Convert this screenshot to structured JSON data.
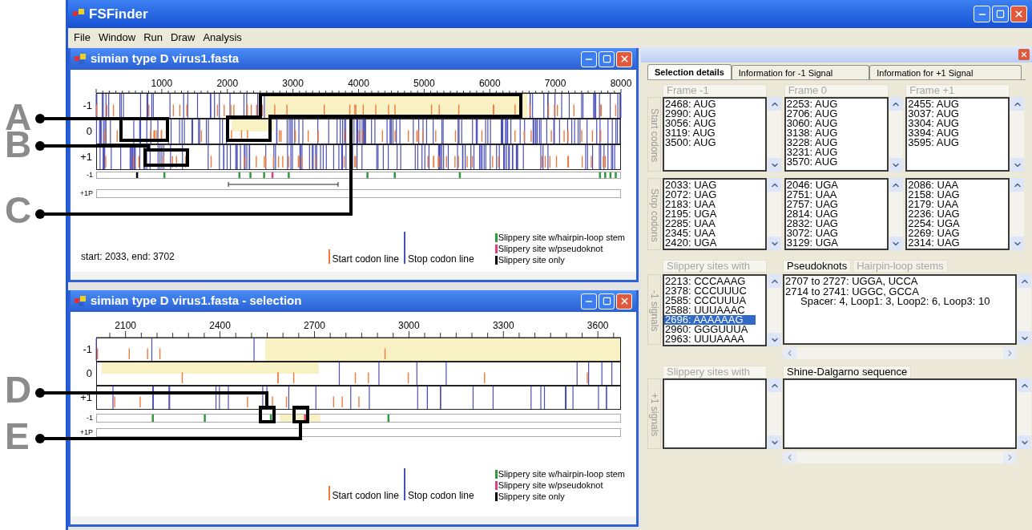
{
  "window": {
    "title": "FSFinder"
  },
  "menu": [
    "File",
    "Window",
    "Run",
    "Draw",
    "Analysis"
  ],
  "callouts": [
    {
      "label": "A"
    },
    {
      "label": "B"
    },
    {
      "label": "C"
    },
    {
      "label": "D"
    },
    {
      "label": "E"
    }
  ],
  "documents": [
    {
      "title": "simian type D virus1.fasta",
      "ticks": [
        "1000",
        "2000",
        "3000",
        "4000",
        "5000",
        "6000",
        "7000",
        "8000"
      ],
      "frames": [
        "-1",
        "0",
        "+1"
      ],
      "signal_tracks": [
        "-1",
        "+1P"
      ],
      "status": "start: 2033, end: 3702",
      "legend": [
        {
          "kind": "start",
          "label": "Start codon line",
          "color": "#f07a3a"
        },
        {
          "kind": "stop",
          "label": "Stop codon line",
          "color": "#4b4fb8"
        },
        {
          "kind": "site",
          "label": "Slippery site w/hairpin-loop stem",
          "color": "#2e9a3c"
        },
        {
          "kind": "site",
          "label": "Slippery site w/pseudoknot",
          "color": "#e0407e"
        },
        {
          "kind": "site",
          "label": "Slippery site only",
          "color": "#000000"
        }
      ]
    },
    {
      "title": "simian type D virus1.fasta - selection",
      "ticks": [
        "2100",
        "2400",
        "2700",
        "3000",
        "3300",
        "3600"
      ],
      "frames": [
        "-1",
        "0",
        "+1"
      ],
      "signal_tracks": [
        "-1",
        "+1P"
      ],
      "legend": [
        {
          "kind": "start",
          "label": "Start codon line",
          "color": "#f07a3a"
        },
        {
          "kind": "stop",
          "label": "Stop codon line",
          "color": "#4b4fb8"
        },
        {
          "kind": "site",
          "label": "Slippery site w/hairpin-loop stem",
          "color": "#2e9a3c"
        },
        {
          "kind": "site",
          "label": "Slippery site w/pseudoknot",
          "color": "#e0407e"
        },
        {
          "kind": "site",
          "label": "Slippery site only",
          "color": "#000000"
        }
      ]
    }
  ],
  "panel": {
    "tabs": [
      {
        "label": "Selection details",
        "selected": true
      },
      {
        "label": "Information for -1 Signal",
        "selected": false
      },
      {
        "label": "Information for +1 Signal",
        "selected": false
      }
    ],
    "row_labels": [
      "Start codons",
      "Stop codons"
    ],
    "frames": [
      {
        "header": "Frame -1",
        "start": [
          "2468: AUG",
          "2990: AUG",
          "3056: AUG",
          "3119: AUG",
          "3500: AUG"
        ],
        "stop": [
          "2033: UAG",
          "2072: UAG",
          "2183: UAA",
          "2195: UGA",
          "2285: UAA",
          "2345: UAA",
          "2420: UGA"
        ]
      },
      {
        "header": "Frame 0",
        "start": [
          "2253: AUG",
          "2706: AUG",
          "3060: AUG",
          "3138: AUG",
          "3228: AUG",
          "3231: AUG",
          "3570: AUG"
        ],
        "stop": [
          "2046: UGA",
          "2751: UAA",
          "2757: UAG",
          "2814: UAG",
          "2832: UAG",
          "3072: UAG",
          "3129: UGA"
        ]
      },
      {
        "header": "Frame +1",
        "start": [
          "2455: AUG",
          "3037: AUG",
          "3304: AUG",
          "3394: AUG",
          "3595: AUG"
        ],
        "stop": [
          "2086: UAA",
          "2158: UAG",
          "2179: UAA",
          "2236: UAG",
          "2254: UGA",
          "2269: UAG",
          "2314: UAG"
        ]
      }
    ],
    "minus1": {
      "label": "-1 signals",
      "header": "Slippery sites with",
      "sites": [
        {
          "text": "2213: CCCAAAG",
          "selected": false
        },
        {
          "text": "2378: CCCUUUC",
          "selected": false
        },
        {
          "text": "2585: CCCUUUA",
          "selected": false
        },
        {
          "text": "2588: UUUAAAC",
          "selected": false
        },
        {
          "text": "2696: AAAAAAG",
          "selected": true
        },
        {
          "text": "2960: GGGUUUA",
          "selected": false
        },
        {
          "text": "2963: UUUAAAA",
          "selected": false
        }
      ],
      "tabs": [
        {
          "label": "Pseudoknots",
          "selected": true
        },
        {
          "label": "Hairpin-loop stems",
          "selected": false
        }
      ],
      "lines": [
        {
          "kind": "pair",
          "text": "2707 to 2727: UGGA, UCCA"
        },
        {
          "kind": "pair",
          "text": "2714 to 2741: UGGC, GCCA"
        },
        {
          "kind": "detail",
          "text": "Spacer: 4, Loop1: 3, Loop2: 6, Loop3: 10"
        }
      ]
    },
    "plus1": {
      "label": "+1 signals",
      "header": "Slippery sites with",
      "tab": "Shine-Dalgarno sequence"
    }
  }
}
